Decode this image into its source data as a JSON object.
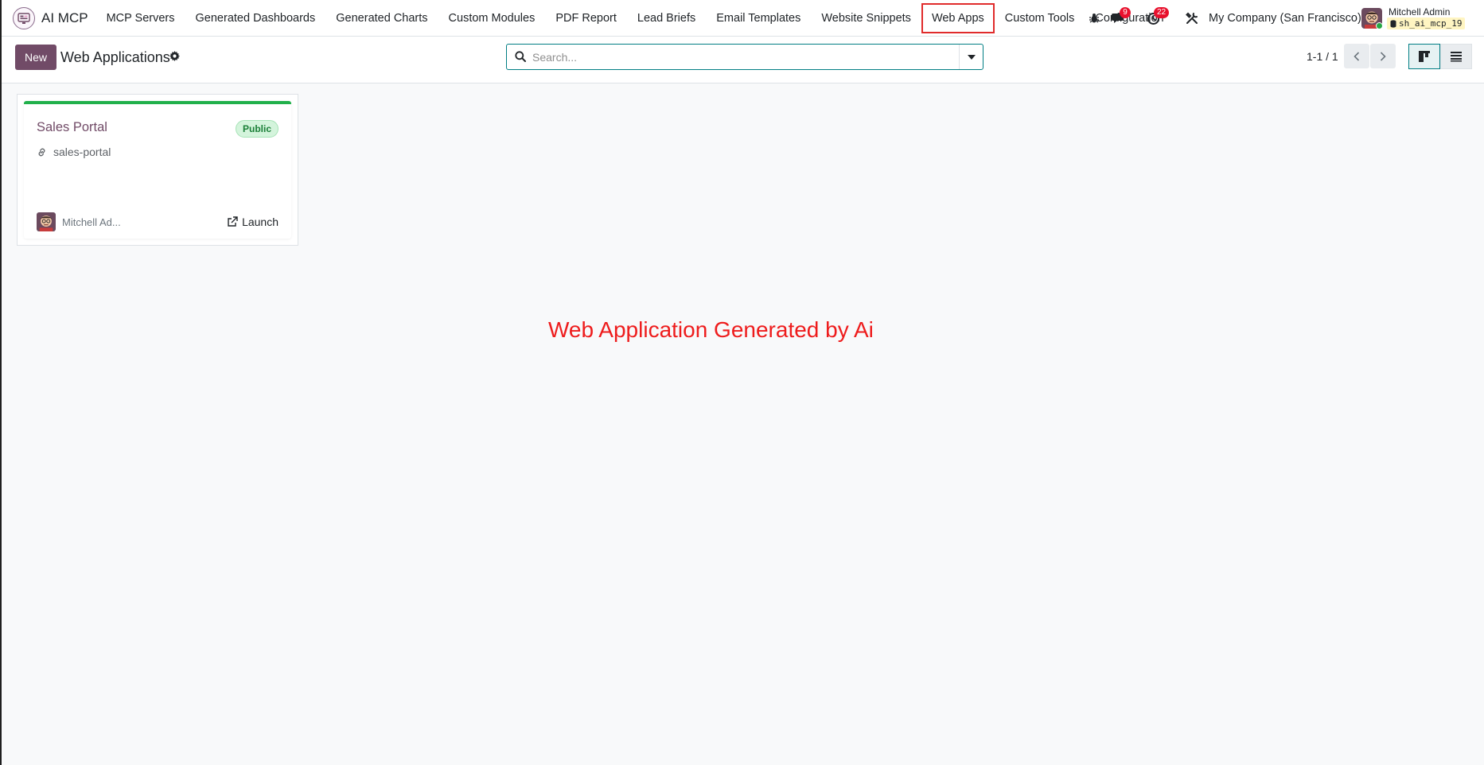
{
  "navbar": {
    "brand": "AI MCP",
    "menu": [
      {
        "id": "mcp-servers",
        "label": "MCP Servers"
      },
      {
        "id": "generated-dashboards",
        "label": "Generated Dashboards"
      },
      {
        "id": "generated-charts",
        "label": "Generated Charts"
      },
      {
        "id": "custom-modules",
        "label": "Custom Modules"
      },
      {
        "id": "pdf-report",
        "label": "PDF Report"
      },
      {
        "id": "lead-briefs",
        "label": "Lead Briefs"
      },
      {
        "id": "email-templates",
        "label": "Email Templates"
      },
      {
        "id": "website-snippets",
        "label": "Website Snippets"
      },
      {
        "id": "web-apps",
        "label": "Web Apps"
      },
      {
        "id": "custom-tools",
        "label": "Custom Tools"
      },
      {
        "id": "configuration",
        "label": "Configuration"
      }
    ],
    "active_menu": "Web Apps",
    "messages_count": "9",
    "activities_count": "22",
    "company": "My Company (San Francisco)",
    "user_name": "Mitchell Admin",
    "database": "sh_ai_mcp_19"
  },
  "control_panel": {
    "new_label": "New",
    "title": "Web Applications",
    "search_placeholder": "Search...",
    "pager": "1-1 / 1"
  },
  "records": [
    {
      "name": "Sales Portal",
      "status": "Public",
      "slug": "sales-portal",
      "owner": "Mitchell Ad...",
      "action": "Launch"
    }
  ],
  "caption": "Web Application Generated by Ai",
  "colors": {
    "primary": "#714b67",
    "accent": "#017e84",
    "status_public": "#21b04b",
    "highlight": "#e02b2b",
    "caption": "#ee1c1c"
  }
}
